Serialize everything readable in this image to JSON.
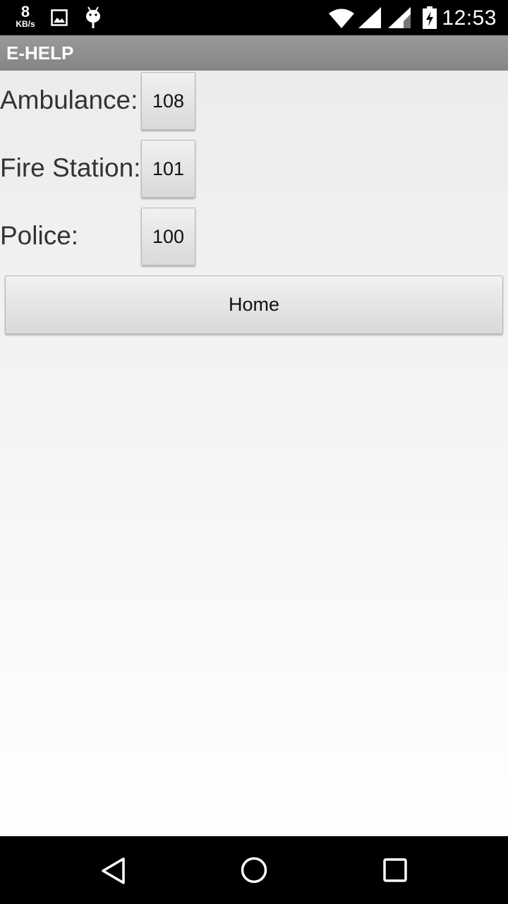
{
  "status_bar": {
    "net_speed_value": "8",
    "net_speed_unit": "KB/s",
    "time": "12:53",
    "icons": [
      "image-notification-icon",
      "android-debug-icon",
      "wifi-icon",
      "signal-icon",
      "signal-icon-2",
      "battery-charging-icon"
    ]
  },
  "action_bar": {
    "title": "E-HELP"
  },
  "contacts": [
    {
      "label": "Ambulance:",
      "number": "108"
    },
    {
      "label": "Fire Station:",
      "number": "101"
    },
    {
      "label": "Police:",
      "number": "100"
    }
  ],
  "home_button": {
    "label": "Home"
  },
  "nav_bar": {
    "icons": [
      "back-icon",
      "home-circle-icon",
      "recents-icon"
    ]
  }
}
